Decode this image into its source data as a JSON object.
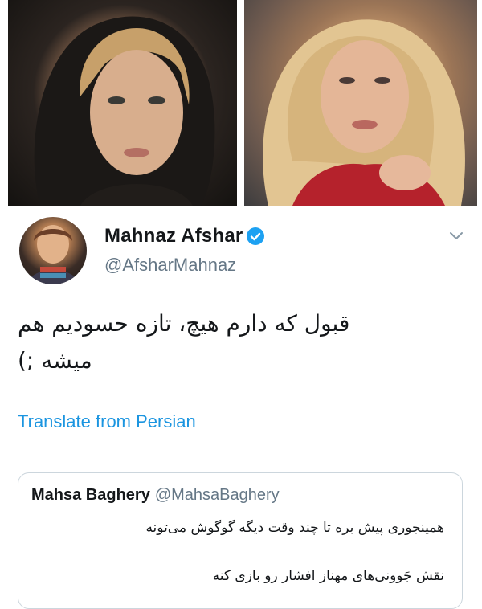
{
  "photos": {
    "left": {
      "description_icon": "woman-portrait-headscarf-image"
    },
    "right": {
      "description_icon": "woman-portrait-blonde-image"
    }
  },
  "tweet": {
    "author_name": "Mahnaz Afshar",
    "author_handle": "@AfsharMahnaz",
    "text": "قبول که دارم هیچ، تازه حسودیم هم میشه ;)",
    "translate_label": "Translate from Persian",
    "verified_color": "#1da1f2",
    "link_color": "#1b95e0"
  },
  "quoted_tweet": {
    "author_name": "Mahsa Baghery",
    "author_handle": "@MahsaBaghery",
    "line1": "همینجوری پیش بره تا چند وقت دیگه گوگوش می‌تونه",
    "line2": "نقش جَوونی‌های مهناز افشار رو بازی کنه"
  }
}
